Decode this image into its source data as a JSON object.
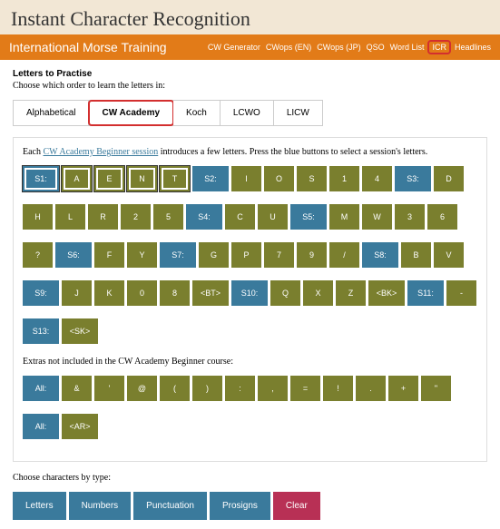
{
  "header": {
    "title": "Instant Character Recognition"
  },
  "nav": {
    "title": "International Morse Training",
    "links": [
      "CW Generator",
      "CWops (EN)",
      "CWops (JP)",
      "QSO",
      "Word List",
      "ICR",
      "Headlines"
    ],
    "highlight": 5
  },
  "section": {
    "title": "Letters to Practise",
    "sub": "Choose which order to learn the letters in:"
  },
  "tabs": [
    "Alphabetical",
    "CW Academy",
    "Koch",
    "LCWO",
    "LICW"
  ],
  "activeTab": 1,
  "desc": {
    "pre": "Each ",
    "link": "CW Academy Beginner session",
    "post": " introduces a few letters. Press the blue buttons to select a session's letters."
  },
  "rows": [
    [
      "S1:",
      "A",
      "E",
      "N",
      "T",
      "S2:",
      "I",
      "O",
      "S",
      "1",
      "4",
      "S3:",
      "D"
    ],
    [
      "H",
      "L",
      "R",
      "2",
      "5",
      "S4:",
      "C",
      "U",
      "S5:",
      "M",
      "W",
      "3",
      "6"
    ],
    [
      "?",
      "S6:",
      "F",
      "Y",
      "S7:",
      "G",
      "P",
      "7",
      "9",
      "/",
      "S8:",
      "B",
      "V"
    ],
    [
      "S9:",
      "J",
      "K",
      "0",
      "8",
      "<BT>",
      "S10:",
      "Q",
      "X",
      "Z",
      "<BK>",
      "S11:",
      "-"
    ],
    [
      "S13:",
      "<SK>"
    ]
  ],
  "sel": [
    "S1:",
    "A",
    "E",
    "N",
    "T"
  ],
  "extrasLabel": "Extras not included in the CW Academy Beginner course:",
  "extras": [
    [
      "All:",
      "&",
      "'",
      "@",
      "(",
      ")",
      ":",
      ",",
      "=",
      "!",
      ".",
      "+",
      "\""
    ],
    [
      "All:",
      "<AR>"
    ]
  ],
  "typeLabel": "Choose characters by type:",
  "typeBtns": [
    "Letters",
    "Numbers",
    "Punctuation",
    "Prosigns",
    "Clear"
  ]
}
